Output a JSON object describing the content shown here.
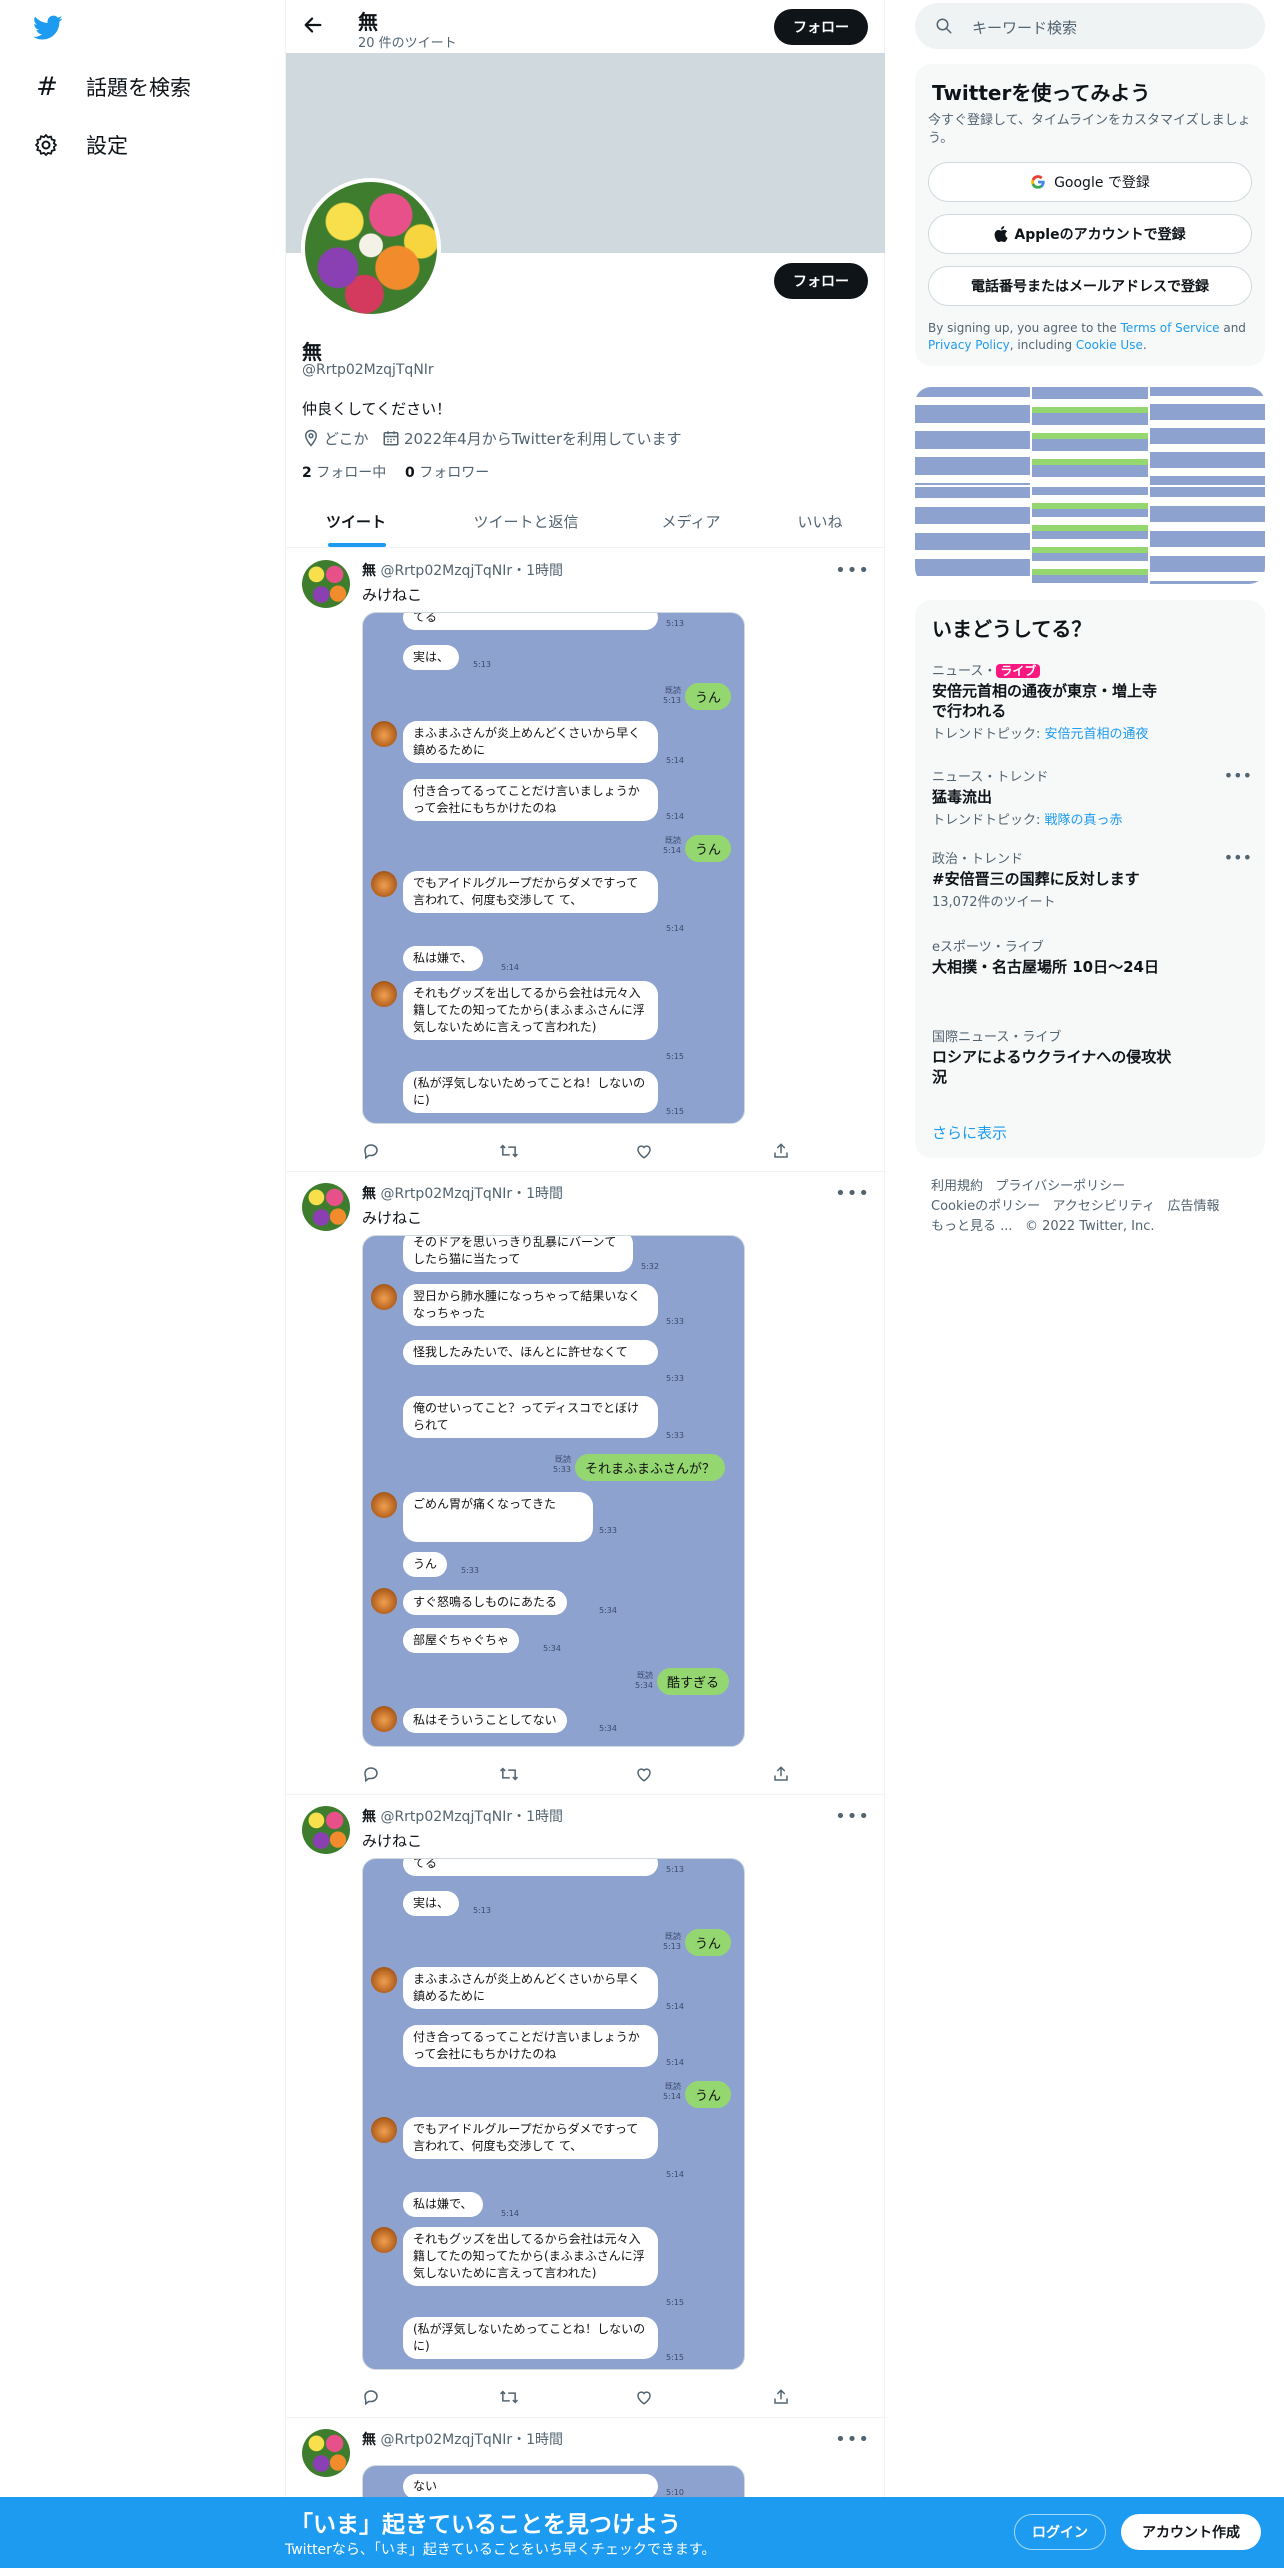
{
  "nav": {
    "explore": "話題を検索",
    "settings": "設定"
  },
  "header": {
    "name": "無",
    "tweet_count": "20 件のツイート",
    "follow": "フォロー"
  },
  "profile": {
    "name": "無",
    "handle": "@Rrtp02MzqjTqNIr",
    "bio": "仲良くしてください！",
    "location": "どこか",
    "joined": "2022年4月からTwitterを利用しています",
    "following_count": "2",
    "following_label": "フォロー中",
    "followers_count": "0",
    "followers_label": "フォロワー",
    "follow": "フォロー"
  },
  "tabs": [
    "ツイート",
    "ツイートと返信",
    "メディア",
    "いいね"
  ],
  "tweets": [
    {
      "name": "無",
      "handle": "@Rrtp02MzqjTqNIr",
      "time": "・1時間",
      "text": "みけねこ"
    },
    {
      "name": "無",
      "handle": "@Rrtp02MzqjTqNIr",
      "time": "・1時間",
      "text": "みけねこ"
    },
    {
      "name": "無",
      "handle": "@Rrtp02MzqjTqNIr",
      "time": "・1時間",
      "text": "みけねこ"
    },
    {
      "name": "無",
      "handle": "@Rrtp02MzqjTqNIr",
      "time": "・1時間",
      "text": ""
    }
  ],
  "chat_a": {
    "m0": "てる",
    "t0": "5:13",
    "m1": "実は、",
    "t1": "5:13",
    "r1": "うん",
    "rt1": "既読\n5:13",
    "m2": "まふまふさんが炎上めんどくさいから早く鎮めるために",
    "t2": "5:14",
    "m3": "付き合ってるってことだけ言いましょうかって会社にもちかけたのね",
    "t3": "5:14",
    "r2": "うん",
    "rt2": "既読\n5:14",
    "m4": "でもアイドルグループだからダメですって言われて、何度も交渉して て、",
    "t4": "5:14",
    "m5": "私は嫌で、",
    "t5": "5:14",
    "m6": "それもグッズを出してるから会社は元々入籍してたの知ってたから(まふまふさんに浮気しないために言えって言われた)",
    "t6": "5:15",
    "m7": "(私が浮気しないためってことね！しないのに)",
    "t7": "5:15"
  },
  "chat_b": {
    "m0": "そのドアを思いっきり乱暴にバーンてしたら猫に当たって",
    "t0": "5:32",
    "m1": "翌日から肺水腫になっちゃって結果いなくなっちゃった",
    "t1": "5:33",
    "m2": "怪我したみたいで、ほんとに許せなくて",
    "t2": "5:33",
    "m3": "俺のせいってこと？ってディスコでとぼけられて",
    "t3": "5:33",
    "r1": "それまふまふさんが？",
    "rt1": "既読\n5:33",
    "m4": "ごめん胃が痛くなってきた",
    "t4": "5:33",
    "m5": "うん",
    "t5": "5:33",
    "m6": "すぐ怒鳴るしものにあたる",
    "t6": "5:34",
    "m7": "部屋ぐちゃぐちゃ",
    "t7": "5:34",
    "r2": "酷すぎる",
    "rt2": "既読\n5:34",
    "m8": "私はそういうことしてない",
    "t8": "5:34"
  },
  "chat_d": {
    "m0": "ない",
    "t0": "5:10"
  },
  "search": {
    "placeholder": "キーワード検索"
  },
  "signup": {
    "title": "Twitterを使ってみよう",
    "desc": "今すぐ登録して、タイムラインをカスタマイズしましょう。",
    "google": "Google で登録",
    "apple": "Appleのアカウントで登録",
    "phone": "電話番号またはメールアドレスで登録",
    "terms_a": "By signing up, you agree to the ",
    "terms_link": "Terms of Service",
    "terms_b": " and ",
    "privacy_link": "Privacy Policy",
    "terms_c": ", including ",
    "cookie_link": "Cookie Use",
    "terms_d": "."
  },
  "trends": {
    "title": "いまどうしてる？",
    "items": [
      {
        "context": "ニュース・",
        "badge": "ライブ",
        "title": "安倍元首相の通夜が東京・増上寺で行われる",
        "sub_label": "トレンドトピック: ",
        "sub_link": "安倍元首相の通夜"
      },
      {
        "context": "ニュース・トレンド",
        "title": "猛毒流出",
        "sub_label": "トレンドトピック: ",
        "sub_link": "戦隊の真っ赤"
      },
      {
        "context": "政治・トレンド",
        "title": "#安倍晋三の国葬に反対します",
        "sub": "13,072件のツイート"
      },
      {
        "context": "eスポーツ・ライブ",
        "title": "大相撲・名古屋場所 10日〜24日"
      },
      {
        "context": "国際ニュース・ライブ",
        "title": "ロシアによるウクライナへの侵攻状況"
      }
    ],
    "more": "さらに表示"
  },
  "footer": {
    "l1": [
      "利用規約",
      "プライバシーポリシー"
    ],
    "l2": [
      "Cookieのポリシー",
      "アクセシビリティ",
      "広告情報"
    ],
    "more": "もっと見る ...",
    "copyright": "© 2022 Twitter, Inc."
  },
  "bottom": {
    "title": "「いま」起きていることを見つけよう",
    "sub": "Twitterなら、「いま」起きていることをいち早くチェックできます。",
    "login": "ログイン",
    "signup": "アカウント作成"
  },
  "colors": {
    "brand": "#1d9bf0",
    "dark": "#0f1419",
    "banner": "#cfd9de",
    "chat_bg": "#8ea2d0",
    "live": "#f91880"
  }
}
